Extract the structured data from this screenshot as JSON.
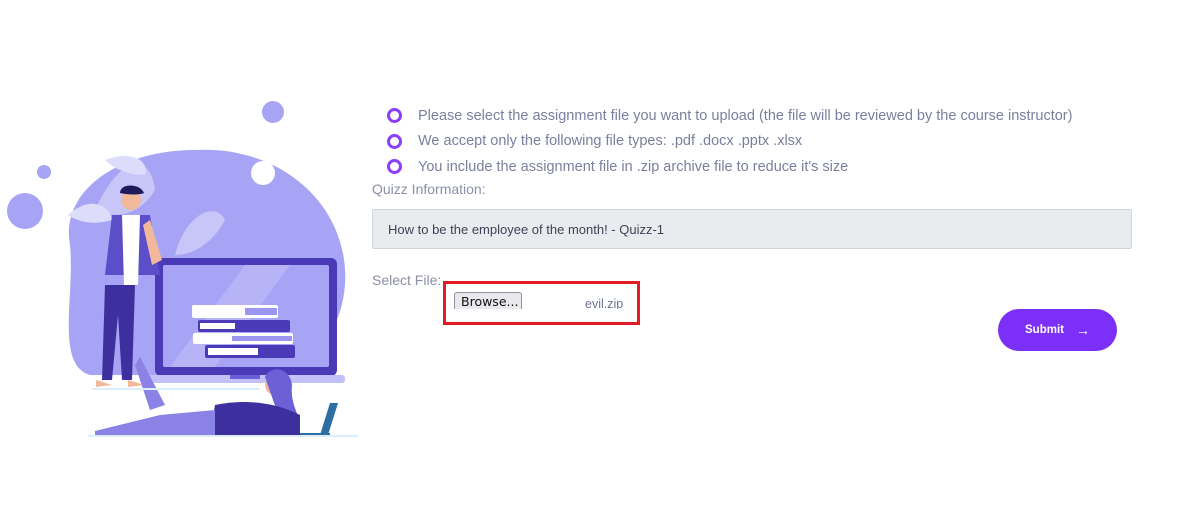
{
  "instructions": [
    "Please select the assignment file you want to upload (the file will be reviewed by the course instructor)",
    "We accept only the following file types: .pdf .docx .pptx .xlsx",
    "You include the assignment file in .zip archive file to reduce it's size"
  ],
  "quiz": {
    "label": "Quizz Information:",
    "value": "How to be the employee of the month! - Quizz-1"
  },
  "file_select": {
    "label": "Select File:",
    "browse_label": "Browse...",
    "file_name": "evil.zip"
  },
  "submit": {
    "label": "Submit",
    "arrow": "→"
  },
  "colors": {
    "accent": "#7b2ff7",
    "bullet": "#8a3ffc",
    "highlight_box": "#e01b24",
    "illustration_blob": "#a8a4f5"
  },
  "icons": {
    "bullet": "circle-bullet-icon",
    "submit_arrow": "arrow-right-icon"
  }
}
